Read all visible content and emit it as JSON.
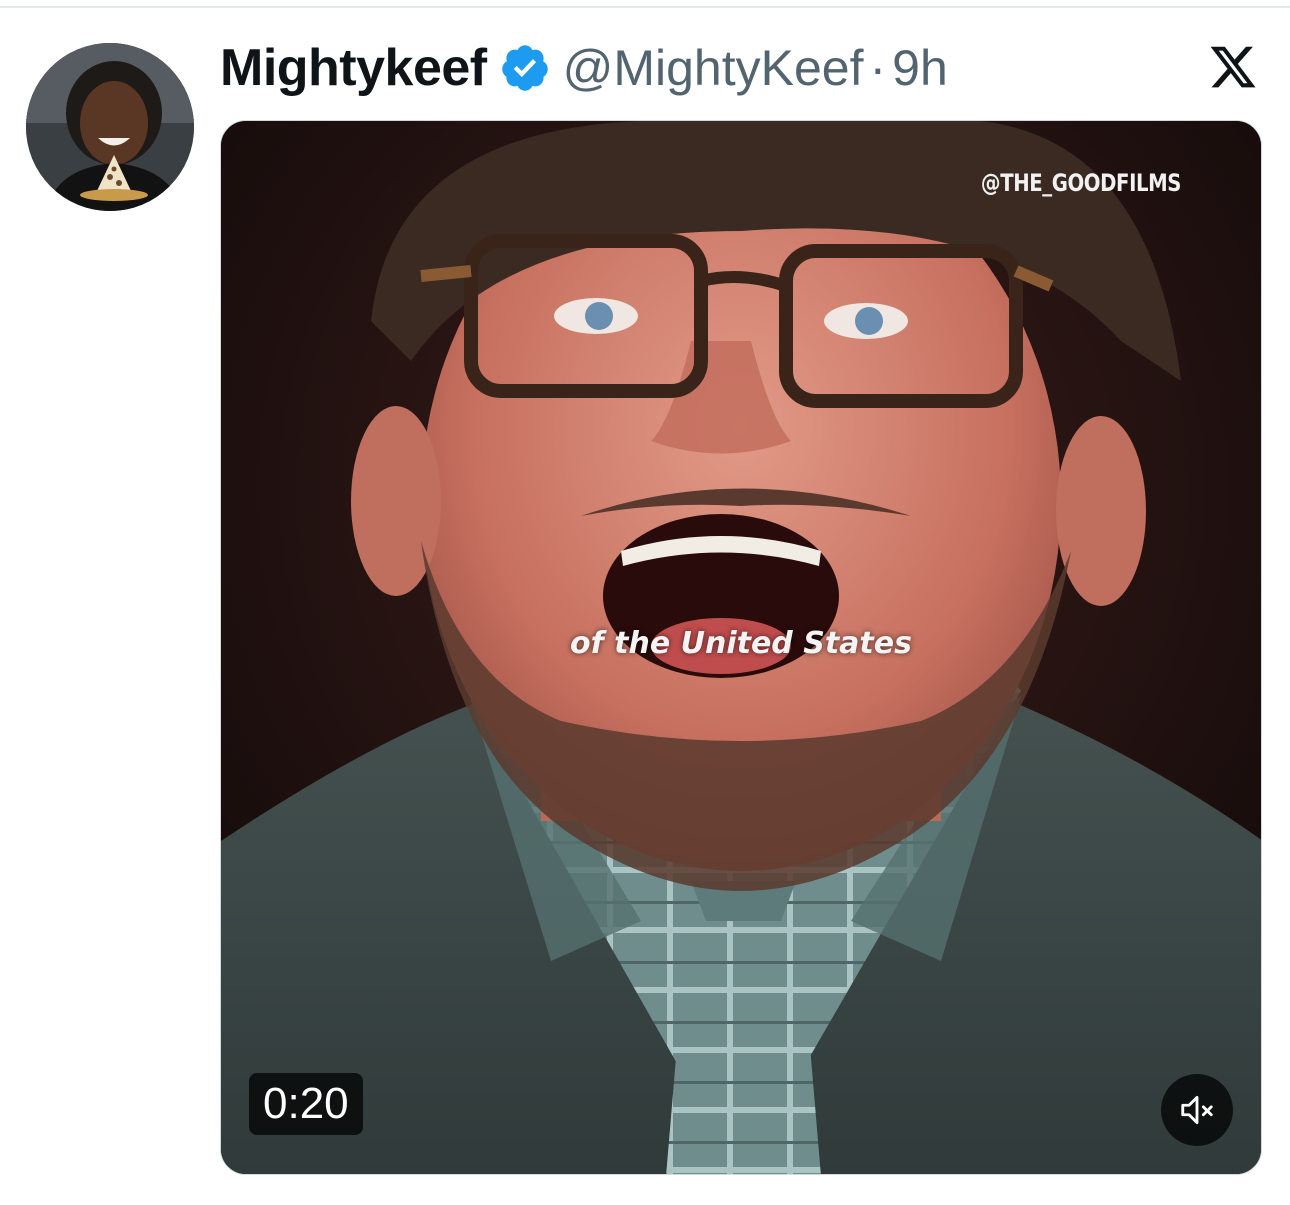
{
  "tweet": {
    "author": {
      "display_name": "Mightykeef",
      "handle": "@MightyKeef",
      "verified": true,
      "avatar_icon": "avatar-photo"
    },
    "separator": "·",
    "timestamp": "9h",
    "platform_icon": "x-logo-icon"
  },
  "media": {
    "watermark": "@THE_GOODFILMS",
    "caption": "of the United States",
    "duration": "0:20",
    "mute_icon": "muted-speaker-icon"
  },
  "colors": {
    "verified_blue": "#1d9bf0",
    "secondary_text": "#536471",
    "primary_text": "#0f1419"
  }
}
